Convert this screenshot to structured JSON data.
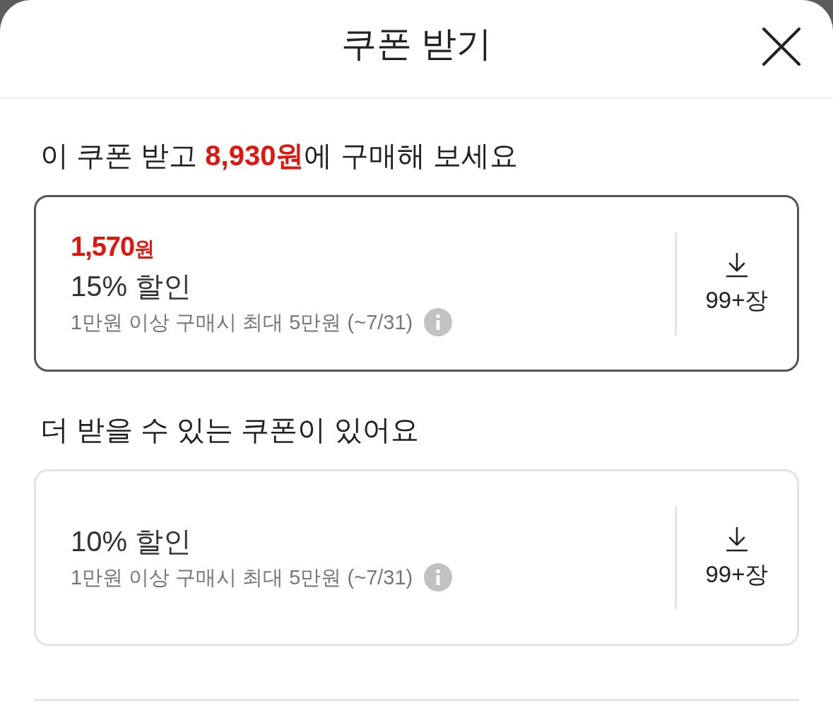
{
  "header": {
    "title": "쿠폰 받기"
  },
  "sections": [
    {
      "heading": "이 쿠폰 받고 **8,930원**에 구매해 보세요",
      "coupons": [
        {
          "amount": "1,570",
          "unit": "원",
          "title": "15% 할인",
          "condition": "1만원 이상 구매시 최대 5만원 (~7/31)",
          "count": "99+장",
          "selected": true
        }
      ]
    },
    {
      "heading": "더 받을 수 있는 쿠폰이 있어요",
      "coupons": [
        {
          "title": "10% 할인",
          "condition": "1만원 이상 구매시 최대 5만원 (~7/31)",
          "count": "99+장",
          "selected": false
        }
      ]
    }
  ]
}
